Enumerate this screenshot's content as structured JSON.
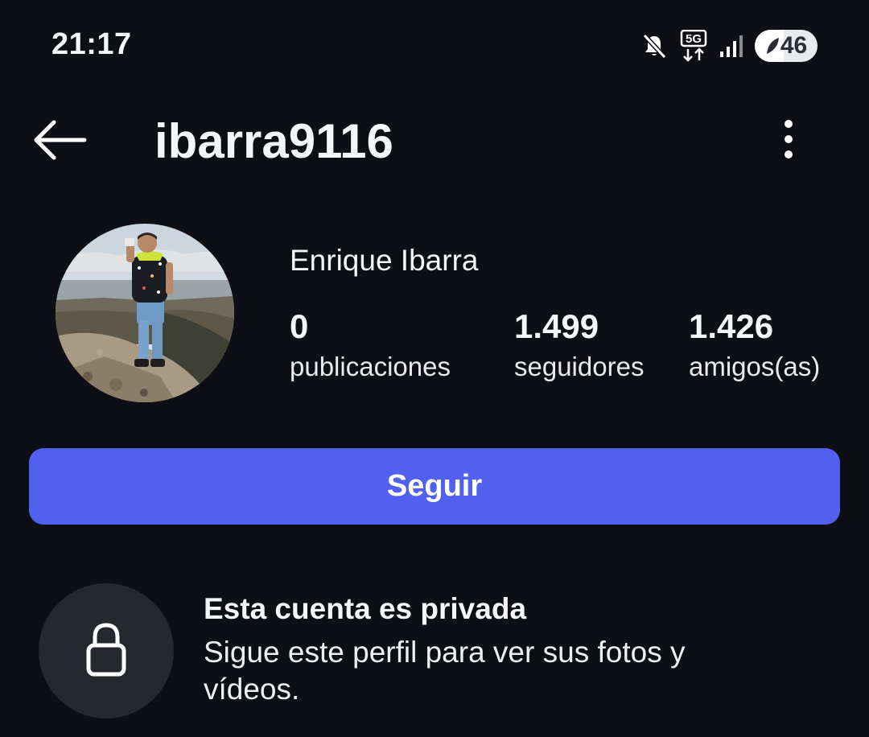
{
  "status_bar": {
    "time": "21:17",
    "network_label": "5G",
    "battery_level": "46",
    "icons": [
      "mute-icon",
      "5g-data-icon",
      "signal-icon",
      "battery-saver-icon"
    ]
  },
  "header": {
    "username": "ibarra9116",
    "back_icon": "arrow-left-icon",
    "menu_icon": "more-vertical-icon"
  },
  "profile": {
    "display_name": "Enrique Ibarra",
    "stats": [
      {
        "value": "0",
        "label": "publicaciones"
      },
      {
        "value": "1.499",
        "label": "seguidores"
      },
      {
        "value": "1.426",
        "label": "amigos(as)"
      }
    ]
  },
  "actions": {
    "follow_label": "Seguir"
  },
  "private_notice": {
    "title": "Esta cuenta es privada",
    "description": "Sigue este perfil para ver sus fotos y vídeos.",
    "icon": "lock-icon"
  },
  "colors": {
    "background": "#0d0f14",
    "accent": "#5160ef",
    "lock_circle": "#25282d"
  }
}
